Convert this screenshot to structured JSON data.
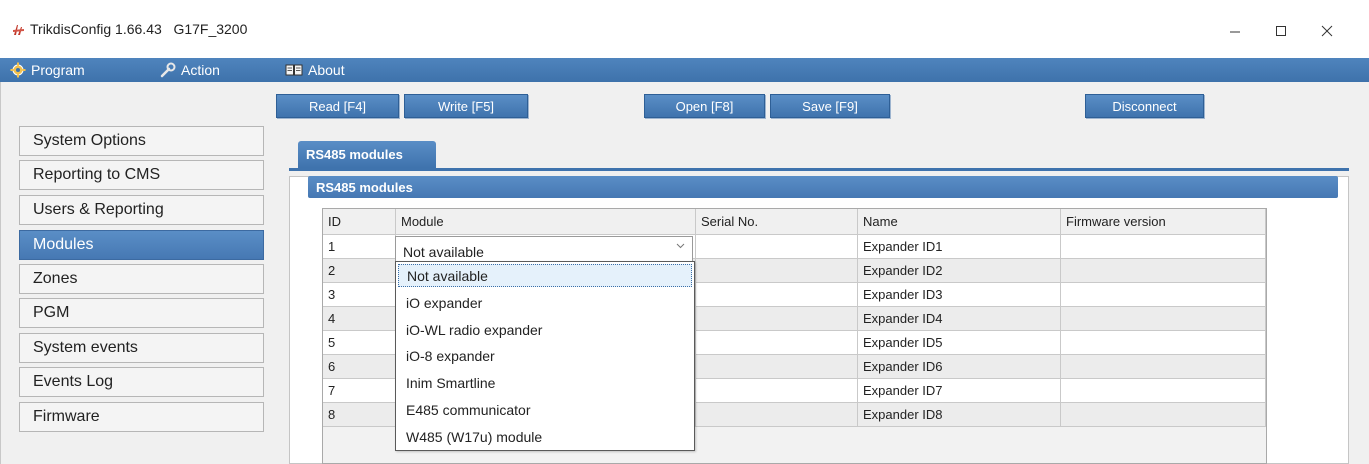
{
  "window": {
    "title": "TrikdisConfig 1.66.43   G17F_3200"
  },
  "menu": {
    "program": "Program",
    "action": "Action",
    "about": "About"
  },
  "toolbar": {
    "read": "Read [F4]",
    "write": "Write [F5]",
    "open": "Open [F8]",
    "save": "Save [F9]",
    "disconnect": "Disconnect"
  },
  "sidebar": {
    "items": [
      {
        "label": "System Options"
      },
      {
        "label": "Reporting to CMS"
      },
      {
        "label": "Users & Reporting"
      },
      {
        "label": "Modules"
      },
      {
        "label": "Zones"
      },
      {
        "label": "PGM"
      },
      {
        "label": "System events"
      },
      {
        "label": "Events Log"
      },
      {
        "label": "Firmware"
      }
    ],
    "active": "Modules"
  },
  "tab": {
    "label": "RS485 modules"
  },
  "group": {
    "title": "RS485 modules"
  },
  "table": {
    "headers": [
      "ID",
      "Module",
      "Serial No.",
      "Name",
      "Firmware version"
    ],
    "rows": [
      {
        "id": "1",
        "module": "Not available",
        "serial": "",
        "name": "Expander ID1",
        "firmware": ""
      },
      {
        "id": "2",
        "module": "",
        "serial": "",
        "name": "Expander ID2",
        "firmware": ""
      },
      {
        "id": "3",
        "module": "",
        "serial": "",
        "name": "Expander ID3",
        "firmware": ""
      },
      {
        "id": "4",
        "module": "",
        "serial": "",
        "name": "Expander ID4",
        "firmware": ""
      },
      {
        "id": "5",
        "module": "",
        "serial": "",
        "name": "Expander ID5",
        "firmware": ""
      },
      {
        "id": "6",
        "module": "",
        "serial": "",
        "name": "Expander ID6",
        "firmware": ""
      },
      {
        "id": "7",
        "module": "",
        "serial": "",
        "name": "Expander ID7",
        "firmware": ""
      },
      {
        "id": "8",
        "module": "",
        "serial": "",
        "name": "Expander ID8",
        "firmware": ""
      }
    ]
  },
  "dropdown": {
    "selected": "Not available",
    "options": [
      "Not available",
      "iO expander",
      "iO-WL radio expander",
      "iO-8 expander",
      "Inim Smartline",
      "E485 communicator",
      "W485 (W17u) module"
    ]
  },
  "colors": {
    "accent": "#4678b3",
    "menubar": "#4a7fb8",
    "selection": "#e5f1fb"
  }
}
